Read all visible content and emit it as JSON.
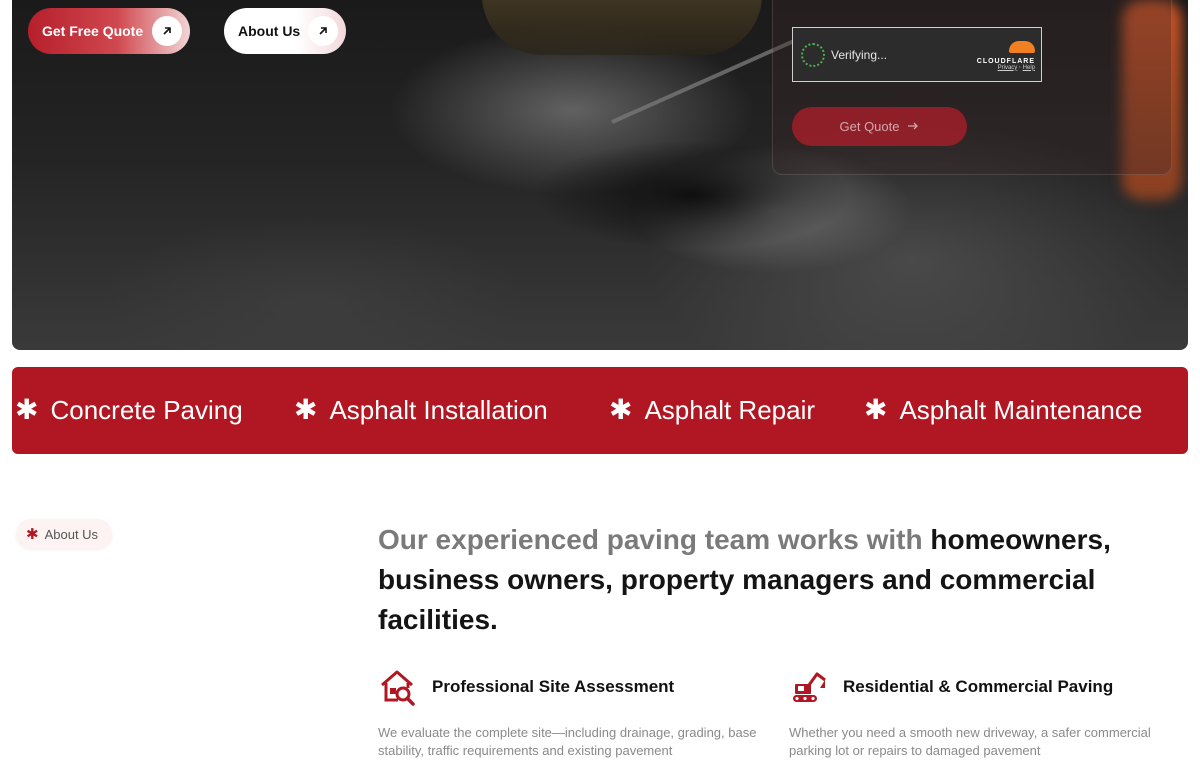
{
  "hero": {
    "buttons": {
      "quote_label": "Get Free Quote",
      "about_label": "About Us"
    },
    "captcha": {
      "status": "Verifying...",
      "brand": "CLOUDFLARE",
      "privacy": "Privacy",
      "separator": "·",
      "help": "Help"
    },
    "form_submit_label": "Get Quote"
  },
  "band": {
    "items": [
      "Concrete Paving",
      "Asphalt Installation",
      "Asphalt Repair",
      "Asphalt Maintenance"
    ]
  },
  "about": {
    "pill_label": "About Us",
    "headline_muted": "Our experienced paving team works with ",
    "headline_dark": "homeowners, business owners, property managers and commercial facilities.",
    "features": [
      {
        "icon": "house-search-icon",
        "title": "Professional Site Assessment",
        "desc": "We evaluate the complete site—including drainage, grading, base stability, traffic requirements and existing pavement"
      },
      {
        "icon": "excavator-icon",
        "title": "Residential & Commercial Paving",
        "desc": "Whether you need a smooth new driveway, a safer commercial parking lot or repairs to damaged pavement"
      }
    ]
  },
  "colors": {
    "brand_red": "#b01722",
    "muted_text": "#7a7a7a",
    "dark_text": "#141414"
  }
}
